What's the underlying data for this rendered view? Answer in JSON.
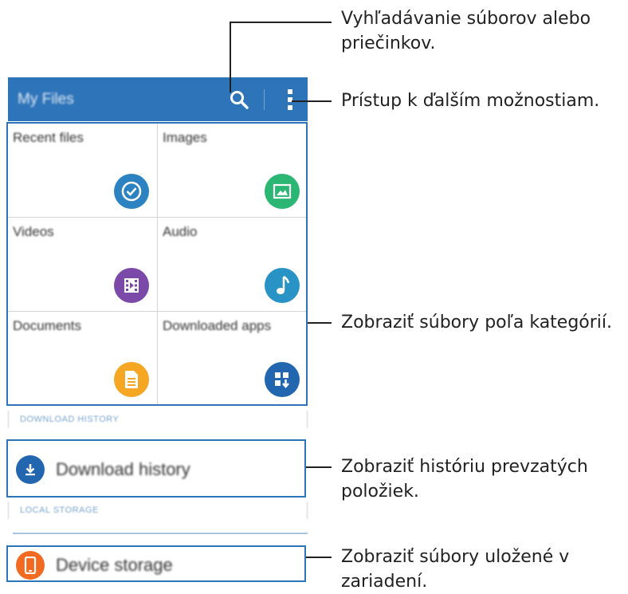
{
  "app": {
    "title": "My Files",
    "toolbar": {
      "search_icon": "search-icon",
      "more_icon": "more-vertical-icon"
    },
    "colors": {
      "appbar": "#2e74b9",
      "highlight": "#2e74b9"
    }
  },
  "categories": [
    {
      "label": "Recent files",
      "icon": "clock-check-icon",
      "color": "#2d82c2"
    },
    {
      "label": "Images",
      "icon": "image-icon",
      "color": "#2bb673"
    },
    {
      "label": "Videos",
      "icon": "film-icon",
      "color": "#7b4aa8"
    },
    {
      "label": "Audio",
      "icon": "music-note-icon",
      "color": "#2a93c6"
    },
    {
      "label": "Documents",
      "icon": "document-icon",
      "color": "#f5a623"
    },
    {
      "label": "Downloaded apps",
      "icon": "apps-download-icon",
      "color": "#2266b0"
    }
  ],
  "download_history": {
    "header": "DOWNLOAD HISTORY",
    "label": "Download history",
    "icon": "download-icon",
    "color": "#2266b0"
  },
  "local_storage": {
    "header": "LOCAL STORAGE",
    "label": "Device storage",
    "icon": "phone-icon",
    "color": "#f26a21"
  },
  "callouts": {
    "search": "Vyhľadávanie súborov alebo priečinkov.",
    "more": "Prístup k ďalším možnostiam.",
    "categories": "Zobraziť súbory poľa kategórií.",
    "history": "Zobraziť históriu prevzatých položiek.",
    "storage": "Zobraziť súbory uložené v zariadení."
  }
}
